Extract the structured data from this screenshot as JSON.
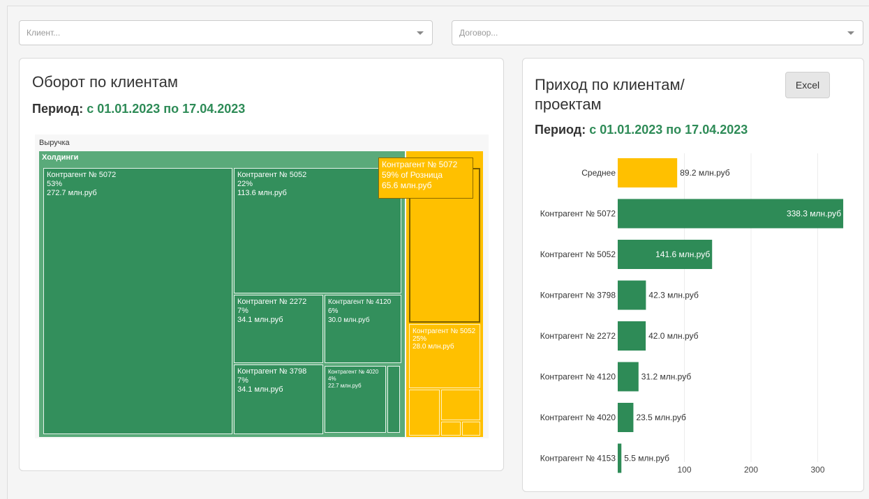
{
  "filters": {
    "client_placeholder": "Клиент...",
    "contract_placeholder": "Договор..."
  },
  "left_panel": {
    "title": "Оборот по клиентам",
    "period_label": "Период:",
    "period_value": "с 01.01.2023 по 17.04.2023",
    "treemap": {
      "root_label": "Выручка",
      "group_green": "Холдинги",
      "nodes": [
        {
          "name": "Контрагент № 5072",
          "pct": "53%",
          "value": "272.7 млн.руб"
        },
        {
          "name": "Контрагент № 5052",
          "pct": "22%",
          "value": "113.6 млн.руб"
        },
        {
          "name": "Контрагент № 2272",
          "pct": "7%",
          "value": "34.1 млн.руб"
        },
        {
          "name": "Контрагент № 4120",
          "pct": "6%",
          "value": "30.0 млн.руб"
        },
        {
          "name": "Контрагент № 3798",
          "pct": "7%",
          "value": "34.1 млн.руб"
        },
        {
          "name": "Контрагент № 4020",
          "pct": "4%",
          "value": "22.7 млн.руб"
        }
      ],
      "retail_nodes": [
        {
          "name": "Контрагент № 5052",
          "pct": "25%",
          "value": "28.0 млн.руб"
        }
      ],
      "tooltip": {
        "line1": "Контрагент № 5072",
        "line2": "59% of Розница",
        "line3": "65.6 млн.руб"
      }
    }
  },
  "right_panel": {
    "title_line1": "Приход по клиентам/",
    "title_line2": "проектам",
    "excel_button": "Excel",
    "period_label": "Период:",
    "period_value": "с 01.01.2023 по 17.04.2023"
  },
  "chart_data": {
    "type": "bar",
    "orientation": "horizontal",
    "categories": [
      "Среднее",
      "Контрагент № 5072",
      "Контрагент № 5052",
      "Контрагент № 3798",
      "Контрагент № 2272",
      "Контрагент № 4120",
      "Контрагент № 4020",
      "Контрагент № 4153"
    ],
    "values": [
      89.2,
      338.3,
      141.6,
      42.3,
      42.0,
      31.2,
      23.5,
      5.5
    ],
    "value_labels": [
      "89.2 млн.руб",
      "338.3 млн.руб",
      "141.6 млн.руб",
      "42.3 млн.руб",
      "42.0 млн.руб",
      "31.2 млн.руб",
      "23.5 млн.руб",
      "5.5 млн.руб"
    ],
    "colors": [
      "#ffc000",
      "#2e8b57",
      "#2e8b57",
      "#2e8b57",
      "#2e8b57",
      "#2e8b57",
      "#2e8b57",
      "#2e8b57"
    ],
    "x_ticks": [
      "100",
      "200",
      "300"
    ],
    "xlim": [
      0,
      340
    ],
    "grid": true
  }
}
